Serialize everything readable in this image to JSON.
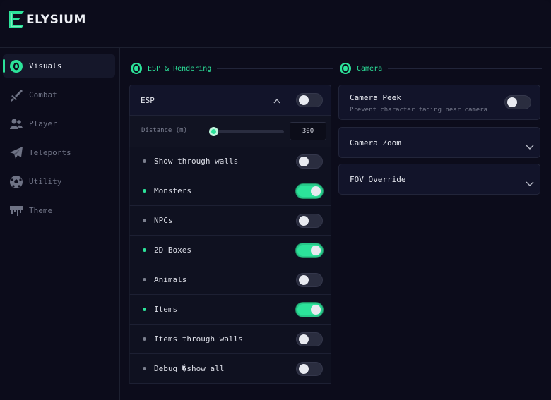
{
  "app": {
    "logo_text": "ELYSIUM",
    "accent_color": "#2ce39a"
  },
  "sidebar": {
    "items": [
      {
        "label": "Visuals",
        "icon": "eye-icon",
        "active": true
      },
      {
        "label": "Combat",
        "icon": "sword-icon",
        "active": false
      },
      {
        "label": "Player",
        "icon": "users-icon",
        "active": false
      },
      {
        "label": "Teleports",
        "icon": "paper-plane-icon",
        "active": false
      },
      {
        "label": "Utility",
        "icon": "soccer-ball-icon",
        "active": false
      },
      {
        "label": "Theme",
        "icon": "paint-drip-icon",
        "active": false
      }
    ]
  },
  "sections": {
    "esp": {
      "title": "ESP & Rendering"
    },
    "camera": {
      "title": "Camera"
    }
  },
  "esp": {
    "label": "ESP",
    "enabled": false,
    "distance": {
      "label": "Distance (m)",
      "value": "300",
      "fraction": 0.0
    },
    "options": [
      {
        "label": "Show through walls",
        "on": false
      },
      {
        "label": "Monsters",
        "on": true
      },
      {
        "label": "NPCs",
        "on": false
      },
      {
        "label": "2D Boxes",
        "on": true
      },
      {
        "label": "Animals",
        "on": false
      },
      {
        "label": "Items",
        "on": true
      },
      {
        "label": "Items through walls",
        "on": false
      },
      {
        "label": "Debug �show all",
        "on": false
      }
    ]
  },
  "camera": {
    "peek": {
      "title": "Camera Peek",
      "desc": "Prevent character fading near camera",
      "on": false
    },
    "zoom": {
      "title": "Camera Zoom"
    },
    "fov": {
      "title": "FOV Override"
    }
  }
}
